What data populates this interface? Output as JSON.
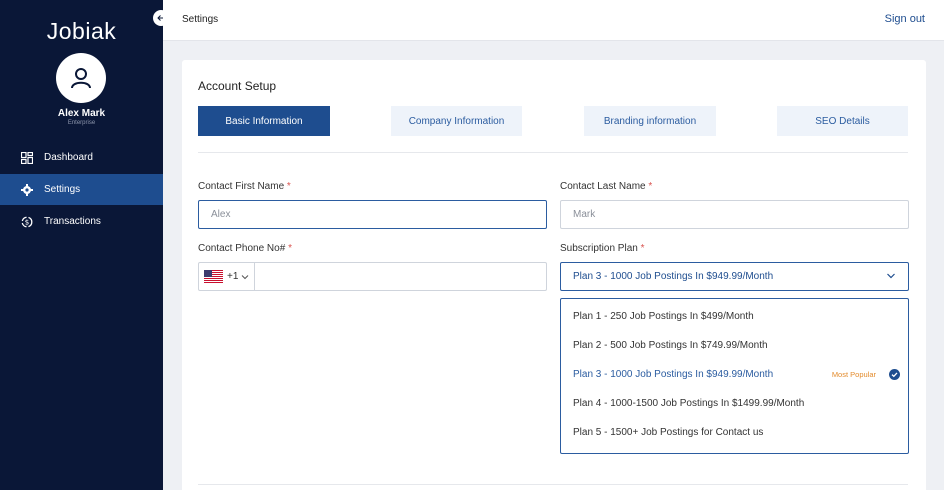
{
  "app": {
    "logo": "Jobiak"
  },
  "user": {
    "name": "Alex Mark",
    "role": "Enterprise"
  },
  "sidebar": {
    "items": [
      {
        "label": "Dashboard",
        "icon": "dashboard-icon"
      },
      {
        "label": "Settings",
        "icon": "gear-icon",
        "active": true
      },
      {
        "label": "Transactions",
        "icon": "transactions-icon"
      }
    ]
  },
  "header": {
    "title": "Settings",
    "signout": "Sign out"
  },
  "card": {
    "title": "Account Setup",
    "tabs": [
      {
        "label": "Basic Information",
        "active": true
      },
      {
        "label": "Company Information"
      },
      {
        "label": "Branding information"
      },
      {
        "label": "SEO Details"
      }
    ]
  },
  "form": {
    "first_name": {
      "label": "Contact First Name",
      "required": "*",
      "placeholder": "Alex"
    },
    "last_name": {
      "label": "Contact Last Name",
      "required": "*",
      "placeholder": "Mark"
    },
    "phone": {
      "label": "Contact Phone No#",
      "required": "*",
      "country_code": "+1",
      "country_flag": "us-flag-icon",
      "value": ""
    },
    "plan": {
      "label": "Subscription Plan",
      "required": "*",
      "selected": "Plan 3 - 1000 Job Postings In $949.99/Month",
      "options": [
        {
          "label": "Plan 1 - 250 Job Postings In $499/Month"
        },
        {
          "label": "Plan 2 - 500 Job Postings In $749.99/Month"
        },
        {
          "label": "Plan 3 - 1000 Job Postings In $949.99/Month",
          "badge": "Most Popular",
          "selected": true
        },
        {
          "label": "Plan 4 - 1000-1500 Job Postings In $1499.99/Month"
        },
        {
          "label": "Plan 5 - 1500+ Job Postings for Contact us"
        }
      ]
    }
  },
  "colors": {
    "sidebar_bg": "#0a1737",
    "accent": "#1e4d8f",
    "badge": "#e38b2c",
    "required": "#d9534f"
  }
}
